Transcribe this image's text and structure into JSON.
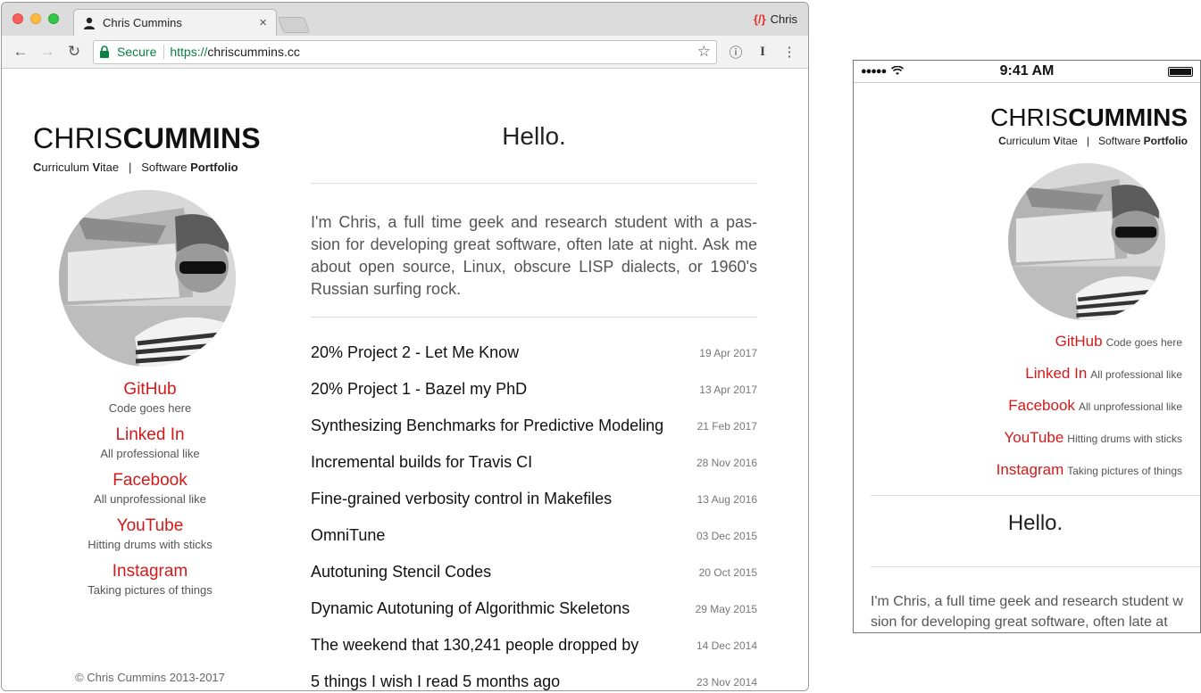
{
  "browser": {
    "tab": {
      "title": "Chris Cummins",
      "close": "×"
    },
    "profile": {
      "icon": "{/}",
      "name": "Chris"
    },
    "nav": {
      "back": "←",
      "forward": "→",
      "reload": "↻"
    },
    "address": {
      "secure_label": "Secure",
      "scheme": "https://",
      "host": "chriscummins.cc"
    },
    "actions": {
      "star": "☆",
      "info": "ⓘ",
      "ext": "I",
      "menu": "⋮"
    }
  },
  "site": {
    "brand": {
      "first": "CHRIS",
      "last": "CUMMINS"
    },
    "subtitle": {
      "cv_c": "C",
      "cv_rest1": "urriculum ",
      "cv_v": "V",
      "cv_rest2": "itae",
      "separator": "|",
      "software": "Software ",
      "portfolio": "Portfolio"
    },
    "socials": [
      {
        "name": "GitHub",
        "desc": "Code goes here"
      },
      {
        "name": "Linked In",
        "desc": "All professional like"
      },
      {
        "name": "Facebook",
        "desc": "All unprofessional like"
      },
      {
        "name": "YouTube",
        "desc": "Hitting drums with sticks"
      },
      {
        "name": "Instagram",
        "desc": "Taking pictures of things"
      }
    ],
    "copyright": "© Chris Cummins 2013-2017",
    "hello": "Hello.",
    "intro": "I'm Chris, a full time geek and research student with a pas-sion for developing great software, often late at night. Ask me about open source, Linux, obscure LISP dialects, or 1960's Russian surfing rock.",
    "posts": [
      {
        "title": "20% Project 2 - Let Me Know",
        "date": "19 Apr 2017"
      },
      {
        "title": "20% Project 1 - Bazel my PhD",
        "date": "13 Apr 2017"
      },
      {
        "title": "Synthesizing Benchmarks for Predictive Modeling",
        "date": "21 Feb 2017"
      },
      {
        "title": "Incremental builds for Travis CI",
        "date": "28 Nov 2016"
      },
      {
        "title": "Fine-grained verbosity control in Makefiles",
        "date": "13 Aug 2016"
      },
      {
        "title": "OmniTune",
        "date": "03 Dec 2015"
      },
      {
        "title": "Autotuning Stencil Codes",
        "date": "20 Oct 2015"
      },
      {
        "title": "Dynamic Autotuning of Algorithmic Skeletons",
        "date": "29 May 2015"
      },
      {
        "title": "The weekend that 130,241 people dropped by",
        "date": "14 Dec 2014"
      },
      {
        "title": "5 things I wish I read 5 months ago",
        "date": "23 Nov 2014"
      }
    ]
  },
  "phone": {
    "signal": "●●●●●",
    "time": "9:41 AM",
    "intro_line1": "I'm Chris, a full time geek and research student w",
    "intro_line2": "sion for developing great software, often late at"
  },
  "colors": {
    "accent": "#d11a1a",
    "secure": "#0b8043"
  }
}
